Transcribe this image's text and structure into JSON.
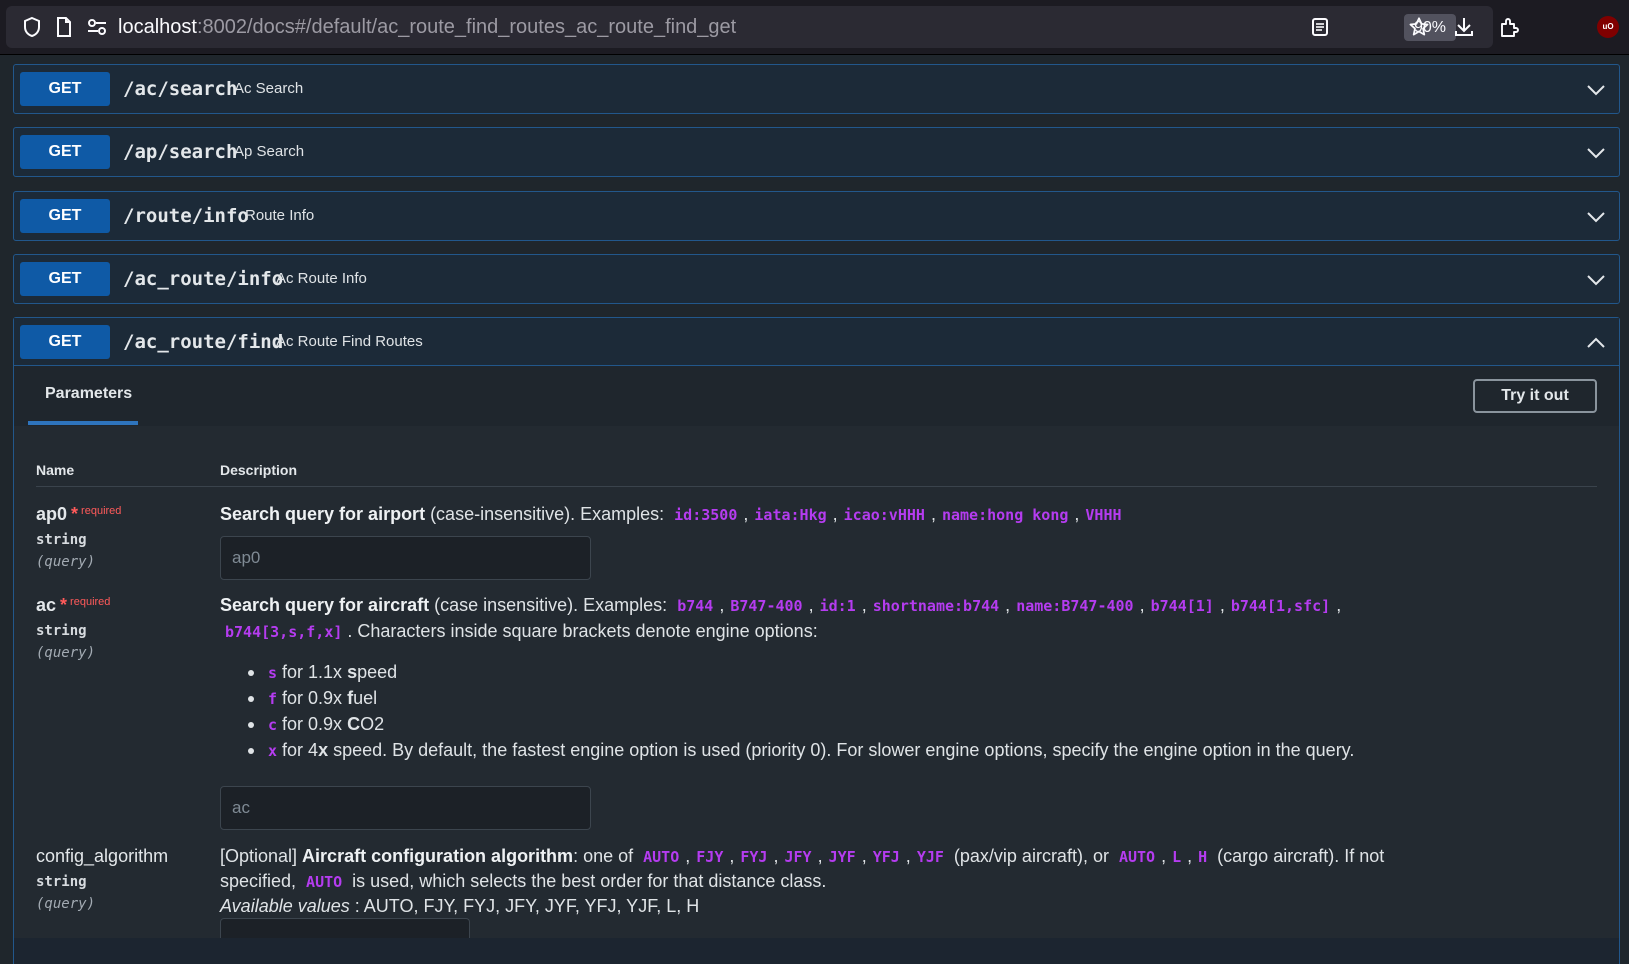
{
  "browser": {
    "url_host": "localhost",
    "url_rest": ":8002/docs#/default/ac_route_find_routes_ac_route_find_get",
    "zoom": "90%",
    "extension_badge": "uO",
    "icons": [
      "shield-icon",
      "page-icon",
      "permissions-icon",
      "reader-view-icon",
      "bookmark-star-icon",
      "download-icon",
      "extensions-icon",
      "ublock-icon"
    ]
  },
  "operations": [
    {
      "method": "GET",
      "path": "/ac/search",
      "summary": "Ac Search"
    },
    {
      "method": "GET",
      "path": "/ap/search",
      "summary": "Ap Search"
    },
    {
      "method": "GET",
      "path": "/route/info",
      "summary": "Route Info"
    },
    {
      "method": "GET",
      "path": "/ac_route/info",
      "summary": "Ac Route Info"
    },
    {
      "method": "GET",
      "path": "/ac_route/find",
      "summary": "Ac Route Find Routes"
    }
  ],
  "expanded": {
    "tab_label": "Parameters",
    "try_button": "Try it out",
    "col_name": "Name",
    "col_description": "Description",
    "params": [
      {
        "name": "ap0",
        "required_star": "*",
        "required_text": "required",
        "type": "string",
        "in": "(query)",
        "desc_bold": "Search query for airport",
        "desc_text": " (case-insensitive). Examples: ",
        "examples": [
          "id:3500",
          "iata:Hkg",
          "icao:vHHH",
          "name:hong kong",
          "VHHH"
        ],
        "placeholder": "ap0"
      },
      {
        "name": "ac",
        "required_star": "*",
        "required_text": "required",
        "type": "string",
        "in": "(query)",
        "desc_bold": "Search query for aircraft",
        "desc_text": " (case insensitive). Examples: ",
        "examples": [
          "b744",
          "B747-400",
          "id:1",
          "shortname:b744",
          "name:B747-400",
          "b744[1]",
          "b744[1,sfc]"
        ],
        "examples_line2": "b744[3,s,f,x]",
        "desc_tail": ". Characters inside square brackets denote engine options:",
        "options": [
          {
            "code": "s",
            "pre": "for 1.1x ",
            "bold": "s",
            "post": "peed"
          },
          {
            "code": "f",
            "pre": "for 0.9x ",
            "bold": "f",
            "post": "uel"
          },
          {
            "code": "c",
            "pre": "for 0.9x ",
            "bold": "C",
            "post": "O2"
          },
          {
            "code": "x",
            "pre": "for 4",
            "bold": "x",
            "post": " speed. By default, the fastest engine option is used (priority 0). For slower engine options, specify the engine option in the query."
          }
        ],
        "placeholder": "ac"
      },
      {
        "name": "config_algorithm",
        "type": "string",
        "in": "(query)",
        "desc_prefix": "[Optional] ",
        "desc_bold": "Aircraft configuration algorithm",
        "desc_text": ": one of ",
        "pax_values": [
          "AUTO",
          "FJY",
          "FYJ",
          "JFY",
          "JYF",
          "YFJ",
          "YJF"
        ],
        "pax_text": " (pax/vip aircraft), or ",
        "cargo_values": [
          "AUTO",
          "L",
          "H"
        ],
        "cargo_text": " (cargo aircraft). If not",
        "line2_pre": "specified, ",
        "line2_code": "AUTO",
        "line2_post": " is used, which selects the best order for that distance class.",
        "available_label": "Available values",
        "available_values": " : AUTO, FJY, FYJ, JFY, JYF, YFJ, YJF, L, H"
      }
    ]
  }
}
